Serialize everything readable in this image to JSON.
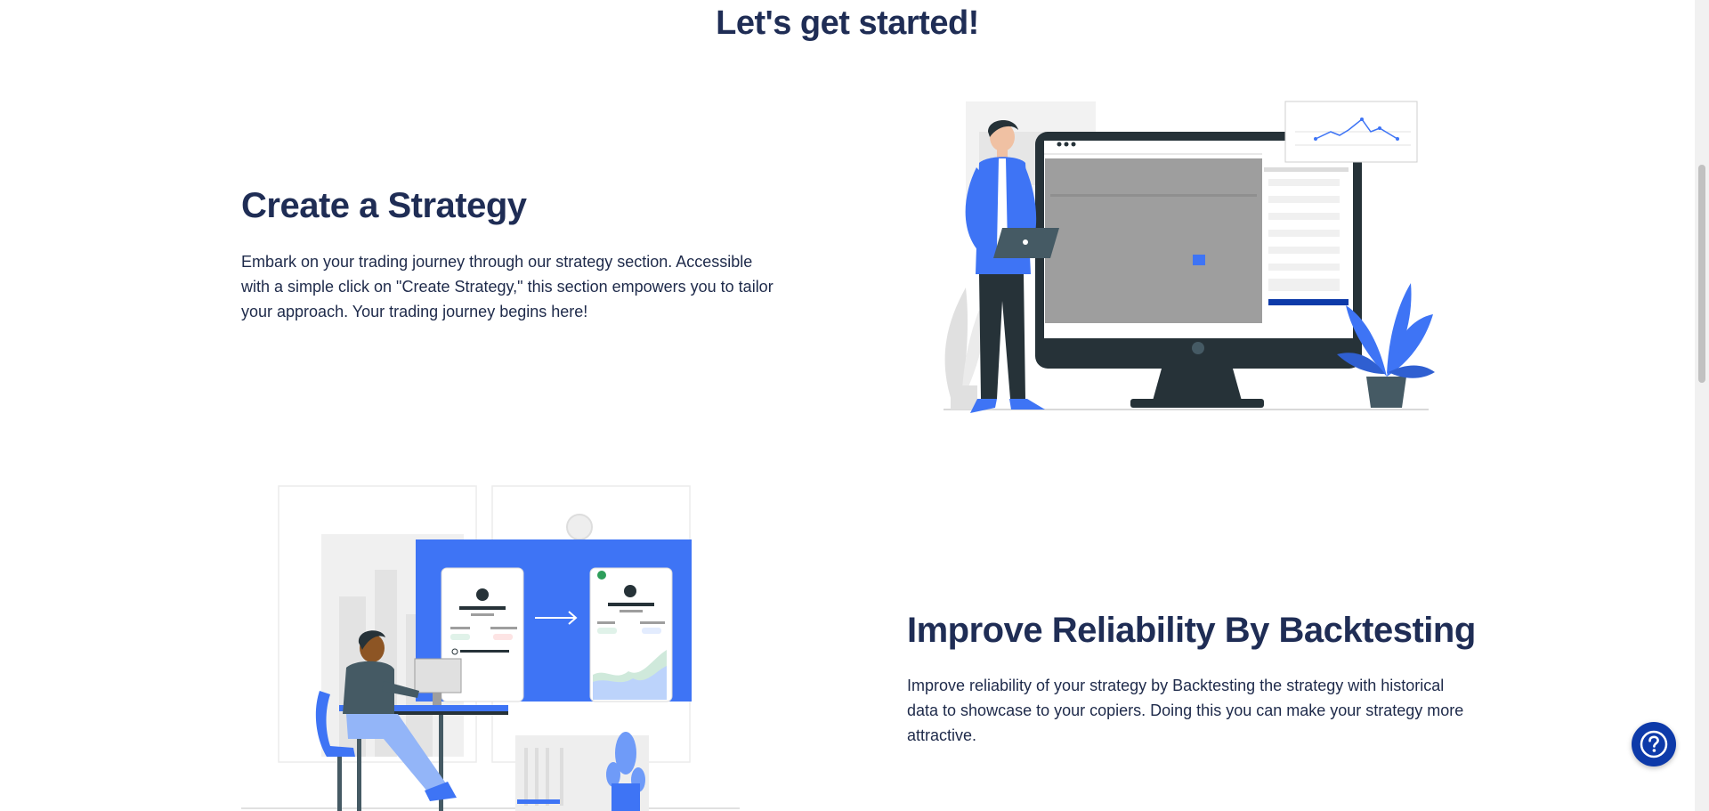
{
  "main": {
    "heading": "Let's get started!"
  },
  "sections": [
    {
      "title": "Create a Strategy",
      "body": "Embark on your trading journey through our strategy section. Accessible with a simple click on \"Create Strategy,\" this section empowers you to tailor your approach. Your trading journey begins here!",
      "illustration": "person-with-laptop-beside-monitor-illustration"
    },
    {
      "title": "Improve Reliability By Backtesting",
      "body": "Improve reliability of your strategy by Backtesting the strategy with historical data to showcase to your copiers. Doing this you can make your strategy more attractive.",
      "illustration": "person-at-desk-backtesting-illustration"
    }
  ],
  "help": {
    "icon": "question-circle-icon"
  },
  "colors": {
    "heading": "#1f2d55",
    "accent": "#3e74f5",
    "help_button": "#0d3aa9",
    "monitor": "#263238"
  }
}
